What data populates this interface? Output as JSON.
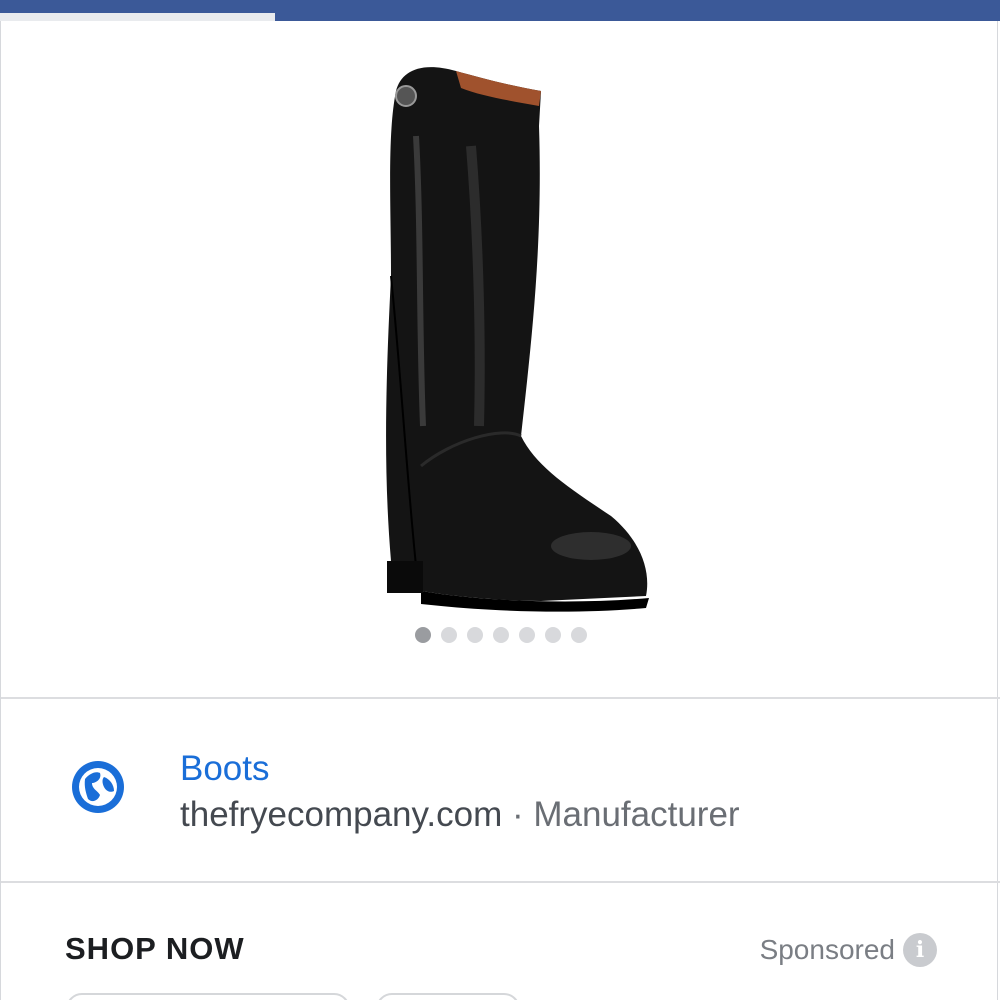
{
  "link": {
    "title": "Boots",
    "domain": "thefryecompany.com",
    "separator": " · ",
    "category": "Manufacturer"
  },
  "footer": {
    "cta_label": "SHOP NOW",
    "sponsored_label": "Sponsored",
    "info_glyph": "i"
  },
  "carousel": {
    "total": 7,
    "active_index": 0
  },
  "progress": {
    "fraction": 0.275
  },
  "colors": {
    "brand_bar": "#3b5998",
    "link": "#1a6ed8",
    "globe": "#1a6ed8"
  },
  "icons": {
    "globe": "globe-icon",
    "info": "info-icon"
  }
}
